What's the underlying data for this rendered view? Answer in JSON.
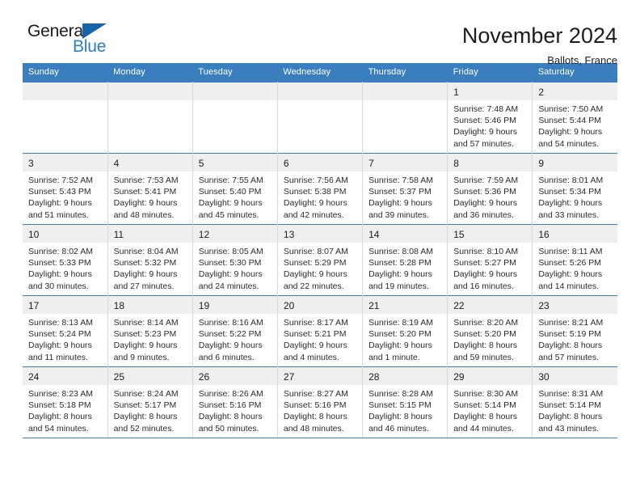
{
  "brand": {
    "word_general": "General",
    "word_blue": "Blue",
    "logo_icon": "triangle-icon",
    "accent_color": "#2a7fc9",
    "triangle_color": "#1565a8"
  },
  "header": {
    "title": "November 2024",
    "location": "Ballots, France",
    "header_bg_color": "#3a7ebf",
    "day_strip_color": "#efefef"
  },
  "weekdays": [
    "Sunday",
    "Monday",
    "Tuesday",
    "Wednesday",
    "Thursday",
    "Friday",
    "Saturday"
  ],
  "labels": {
    "sunrise_prefix": "Sunrise:",
    "sunset_prefix": "Sunset:",
    "daylight_prefix": "Daylight:"
  },
  "weeks": [
    [
      {
        "empty": true
      },
      {
        "empty": true
      },
      {
        "empty": true
      },
      {
        "empty": true
      },
      {
        "empty": true
      },
      {
        "day": "1",
        "sunrise": "Sunrise: 7:48 AM",
        "sunset": "Sunset: 5:46 PM",
        "daylight1": "Daylight: 9 hours",
        "daylight2": "and 57 minutes."
      },
      {
        "day": "2",
        "sunrise": "Sunrise: 7:50 AM",
        "sunset": "Sunset: 5:44 PM",
        "daylight1": "Daylight: 9 hours",
        "daylight2": "and 54 minutes."
      }
    ],
    [
      {
        "day": "3",
        "sunrise": "Sunrise: 7:52 AM",
        "sunset": "Sunset: 5:43 PM",
        "daylight1": "Daylight: 9 hours",
        "daylight2": "and 51 minutes."
      },
      {
        "day": "4",
        "sunrise": "Sunrise: 7:53 AM",
        "sunset": "Sunset: 5:41 PM",
        "daylight1": "Daylight: 9 hours",
        "daylight2": "and 48 minutes."
      },
      {
        "day": "5",
        "sunrise": "Sunrise: 7:55 AM",
        "sunset": "Sunset: 5:40 PM",
        "daylight1": "Daylight: 9 hours",
        "daylight2": "and 45 minutes."
      },
      {
        "day": "6",
        "sunrise": "Sunrise: 7:56 AM",
        "sunset": "Sunset: 5:38 PM",
        "daylight1": "Daylight: 9 hours",
        "daylight2": "and 42 minutes."
      },
      {
        "day": "7",
        "sunrise": "Sunrise: 7:58 AM",
        "sunset": "Sunset: 5:37 PM",
        "daylight1": "Daylight: 9 hours",
        "daylight2": "and 39 minutes."
      },
      {
        "day": "8",
        "sunrise": "Sunrise: 7:59 AM",
        "sunset": "Sunset: 5:36 PM",
        "daylight1": "Daylight: 9 hours",
        "daylight2": "and 36 minutes."
      },
      {
        "day": "9",
        "sunrise": "Sunrise: 8:01 AM",
        "sunset": "Sunset: 5:34 PM",
        "daylight1": "Daylight: 9 hours",
        "daylight2": "and 33 minutes."
      }
    ],
    [
      {
        "day": "10",
        "sunrise": "Sunrise: 8:02 AM",
        "sunset": "Sunset: 5:33 PM",
        "daylight1": "Daylight: 9 hours",
        "daylight2": "and 30 minutes."
      },
      {
        "day": "11",
        "sunrise": "Sunrise: 8:04 AM",
        "sunset": "Sunset: 5:32 PM",
        "daylight1": "Daylight: 9 hours",
        "daylight2": "and 27 minutes."
      },
      {
        "day": "12",
        "sunrise": "Sunrise: 8:05 AM",
        "sunset": "Sunset: 5:30 PM",
        "daylight1": "Daylight: 9 hours",
        "daylight2": "and 24 minutes."
      },
      {
        "day": "13",
        "sunrise": "Sunrise: 8:07 AM",
        "sunset": "Sunset: 5:29 PM",
        "daylight1": "Daylight: 9 hours",
        "daylight2": "and 22 minutes."
      },
      {
        "day": "14",
        "sunrise": "Sunrise: 8:08 AM",
        "sunset": "Sunset: 5:28 PM",
        "daylight1": "Daylight: 9 hours",
        "daylight2": "and 19 minutes."
      },
      {
        "day": "15",
        "sunrise": "Sunrise: 8:10 AM",
        "sunset": "Sunset: 5:27 PM",
        "daylight1": "Daylight: 9 hours",
        "daylight2": "and 16 minutes."
      },
      {
        "day": "16",
        "sunrise": "Sunrise: 8:11 AM",
        "sunset": "Sunset: 5:26 PM",
        "daylight1": "Daylight: 9 hours",
        "daylight2": "and 14 minutes."
      }
    ],
    [
      {
        "day": "17",
        "sunrise": "Sunrise: 8:13 AM",
        "sunset": "Sunset: 5:24 PM",
        "daylight1": "Daylight: 9 hours",
        "daylight2": "and 11 minutes."
      },
      {
        "day": "18",
        "sunrise": "Sunrise: 8:14 AM",
        "sunset": "Sunset: 5:23 PM",
        "daylight1": "Daylight: 9 hours",
        "daylight2": "and 9 minutes."
      },
      {
        "day": "19",
        "sunrise": "Sunrise: 8:16 AM",
        "sunset": "Sunset: 5:22 PM",
        "daylight1": "Daylight: 9 hours",
        "daylight2": "and 6 minutes."
      },
      {
        "day": "20",
        "sunrise": "Sunrise: 8:17 AM",
        "sunset": "Sunset: 5:21 PM",
        "daylight1": "Daylight: 9 hours",
        "daylight2": "and 4 minutes."
      },
      {
        "day": "21",
        "sunrise": "Sunrise: 8:19 AM",
        "sunset": "Sunset: 5:20 PM",
        "daylight1": "Daylight: 9 hours",
        "daylight2": "and 1 minute."
      },
      {
        "day": "22",
        "sunrise": "Sunrise: 8:20 AM",
        "sunset": "Sunset: 5:20 PM",
        "daylight1": "Daylight: 8 hours",
        "daylight2": "and 59 minutes."
      },
      {
        "day": "23",
        "sunrise": "Sunrise: 8:21 AM",
        "sunset": "Sunset: 5:19 PM",
        "daylight1": "Daylight: 8 hours",
        "daylight2": "and 57 minutes."
      }
    ],
    [
      {
        "day": "24",
        "sunrise": "Sunrise: 8:23 AM",
        "sunset": "Sunset: 5:18 PM",
        "daylight1": "Daylight: 8 hours",
        "daylight2": "and 54 minutes."
      },
      {
        "day": "25",
        "sunrise": "Sunrise: 8:24 AM",
        "sunset": "Sunset: 5:17 PM",
        "daylight1": "Daylight: 8 hours",
        "daylight2": "and 52 minutes."
      },
      {
        "day": "26",
        "sunrise": "Sunrise: 8:26 AM",
        "sunset": "Sunset: 5:16 PM",
        "daylight1": "Daylight: 8 hours",
        "daylight2": "and 50 minutes."
      },
      {
        "day": "27",
        "sunrise": "Sunrise: 8:27 AM",
        "sunset": "Sunset: 5:16 PM",
        "daylight1": "Daylight: 8 hours",
        "daylight2": "and 48 minutes."
      },
      {
        "day": "28",
        "sunrise": "Sunrise: 8:28 AM",
        "sunset": "Sunset: 5:15 PM",
        "daylight1": "Daylight: 8 hours",
        "daylight2": "and 46 minutes."
      },
      {
        "day": "29",
        "sunrise": "Sunrise: 8:30 AM",
        "sunset": "Sunset: 5:14 PM",
        "daylight1": "Daylight: 8 hours",
        "daylight2": "and 44 minutes."
      },
      {
        "day": "30",
        "sunrise": "Sunrise: 8:31 AM",
        "sunset": "Sunset: 5:14 PM",
        "daylight1": "Daylight: 8 hours",
        "daylight2": "and 43 minutes."
      }
    ]
  ]
}
